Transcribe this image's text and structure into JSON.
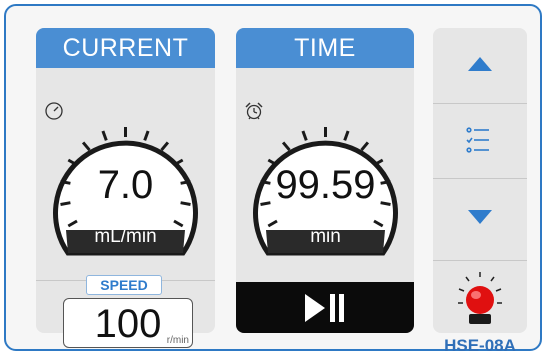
{
  "current": {
    "header": "CURRENT",
    "value": "7.0",
    "unit": "mL/min",
    "icon": "gauge-icon"
  },
  "time": {
    "header": "TIME",
    "value": "99.59",
    "unit": "min",
    "icon": "alarm-clock-icon"
  },
  "speed": {
    "label": "SPEED",
    "value": "100",
    "unit": "r/min"
  },
  "controls": {
    "play_pause_icon": "play-pause-icon",
    "up_icon": "arrow-up-icon",
    "menu_icon": "checklist-icon",
    "down_icon": "arrow-down-icon",
    "indicator_icon": "red-alarm-light-icon"
  },
  "colors": {
    "accent": "#4a8ed3",
    "frame": "#2e79c4",
    "indicator": "#e01010"
  },
  "model": "HSE-08A"
}
